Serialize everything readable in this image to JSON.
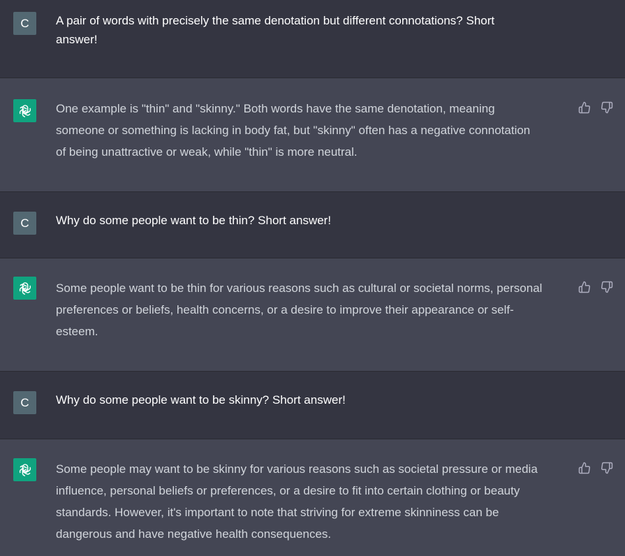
{
  "messages": [
    {
      "role": "user",
      "avatar_label": "C",
      "text": "A pair of words with precisely the same denotation but different connotations? Short\nanswer!"
    },
    {
      "role": "assistant",
      "avatar_icon": "openai-logo-icon",
      "text": "One example is \"thin\" and \"skinny.\" Both words have the same denotation, meaning\nsomeone or something is lacking in body fat, but \"skinny\" often has a negative connotation\nof being unattractive or weak, while \"thin\" is more neutral."
    },
    {
      "role": "user",
      "avatar_label": "C",
      "text": "Why do some people want to be thin? Short answer!"
    },
    {
      "role": "assistant",
      "avatar_icon": "openai-logo-icon",
      "text": "Some people want to be thin for various reasons such as cultural or societal norms, personal\npreferences or beliefs, health concerns, or a desire to improve their appearance or self-\nesteem."
    },
    {
      "role": "user",
      "avatar_label": "C",
      "text": "Why do some people want to be skinny? Short answer!"
    },
    {
      "role": "assistant",
      "avatar_icon": "openai-logo-icon",
      "text": "Some people may want to be skinny for various reasons such as societal pressure or media\ninfluence, personal beliefs or preferences, or a desire to fit into certain clothing or beauty\nstandards. However, it's important to note that striving for extreme skinniness can be\ndangerous and have negative health consequences."
    }
  ],
  "colors": {
    "user_bg": "#343541",
    "assistant_bg": "#444654",
    "user_avatar": "#536872",
    "assistant_avatar": "#10a37f",
    "icon_gray": "#acacbe"
  },
  "icons": {
    "thumbs_up": "thumbs-up-icon",
    "thumbs_down": "thumbs-down-icon"
  }
}
